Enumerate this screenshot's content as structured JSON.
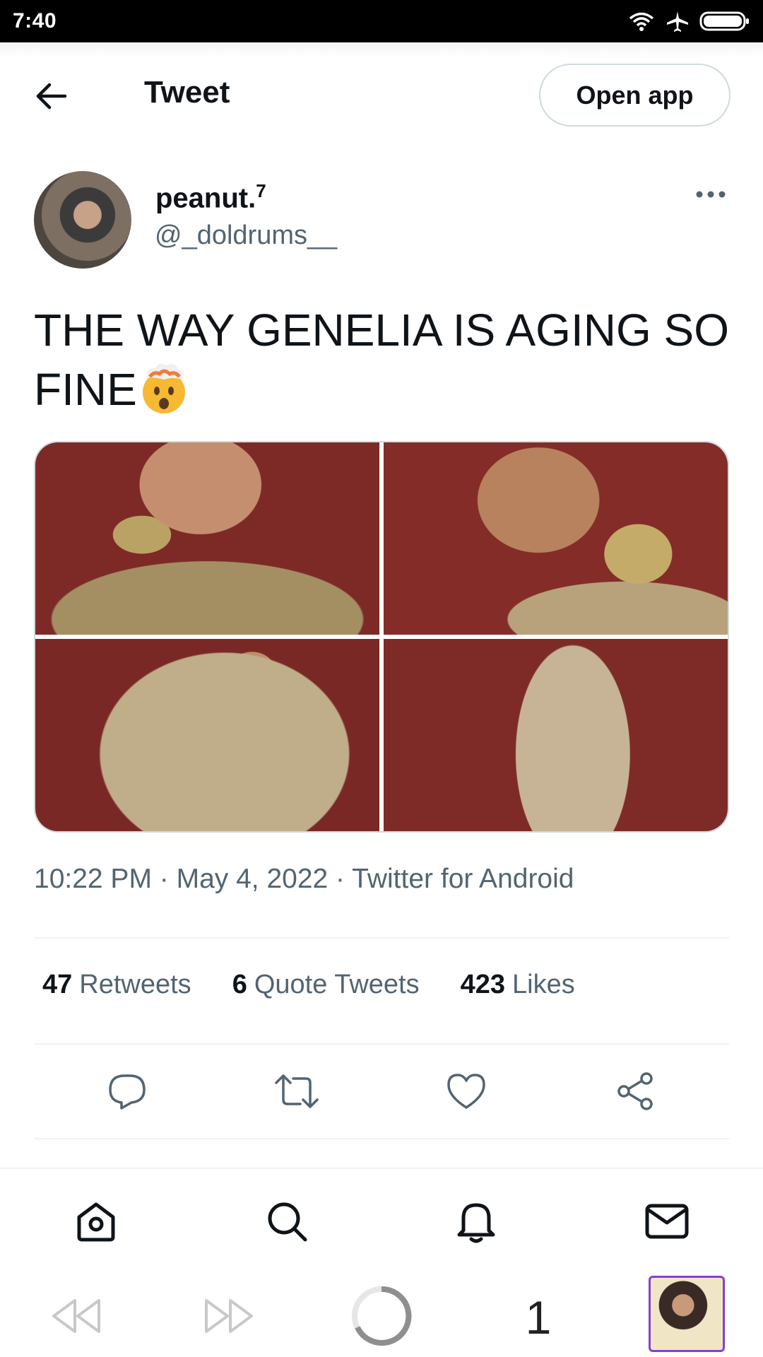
{
  "status_bar": {
    "time": "7:40",
    "icons": [
      "wifi-icon",
      "airplane-mode-icon",
      "battery-icon"
    ]
  },
  "header": {
    "title": "Tweet",
    "open_app_label": "Open app"
  },
  "tweet": {
    "author": {
      "display_name": "peanut.",
      "name_superscript": "7",
      "handle": "@_doldrums__"
    },
    "text": "THE WAY GENELIA IS AGING SO FINE",
    "emoji": "exploding-head-emoji",
    "timestamp": "10:22 PM · May 4, 2022 · Twitter for Android",
    "stats": {
      "retweets": {
        "count": "47",
        "label": "Retweets"
      },
      "quote_tweets": {
        "count": "6",
        "label": "Quote Tweets"
      },
      "likes": {
        "count": "423",
        "label": "Likes"
      }
    }
  },
  "actions": [
    "reply-icon",
    "retweet-icon",
    "like-icon",
    "share-icon"
  ],
  "bottom_nav": [
    "home-icon",
    "search-icon",
    "notifications-icon",
    "messages-icon"
  ],
  "browser_bar": {
    "tab_count": "1"
  },
  "colors": {
    "text_primary": "#0f1419",
    "text_secondary": "#536471",
    "border": "#cfd9de",
    "divider": "#eff3f4"
  }
}
